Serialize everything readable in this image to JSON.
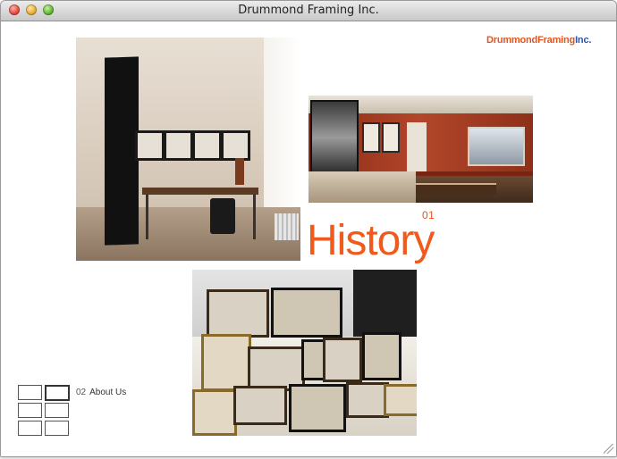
{
  "window": {
    "title": "Drummond Framing Inc."
  },
  "logo": {
    "part1": "Drummond",
    "part2": "Framing",
    "part3": "Inc."
  },
  "section": {
    "number": "01",
    "title": "History"
  },
  "nav": {
    "next_number": "02",
    "next_label": "About Us"
  },
  "photos": [
    {
      "name": "office-photo"
    },
    {
      "name": "living-room-photo"
    },
    {
      "name": "framed-pictures-photo"
    }
  ],
  "colors": {
    "accent": "#ef5b1c",
    "brand_blue": "#2457b8"
  }
}
